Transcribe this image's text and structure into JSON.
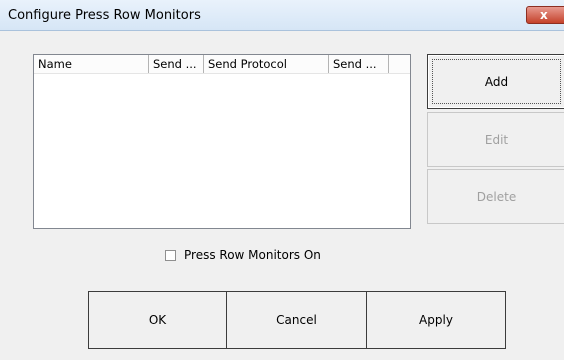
{
  "window": {
    "title": "Configure Press Row Monitors",
    "close_label": "x"
  },
  "list": {
    "columns": [
      "Name",
      "Send ...",
      "Send Protocol",
      "Send ..."
    ],
    "rows": []
  },
  "side_buttons": {
    "add": "Add",
    "edit": "Edit",
    "delete": "Delete"
  },
  "checkbox": {
    "label": "Press Row Monitors On",
    "checked": false
  },
  "bottom_buttons": {
    "ok": "OK",
    "cancel": "Cancel",
    "apply": "Apply"
  }
}
